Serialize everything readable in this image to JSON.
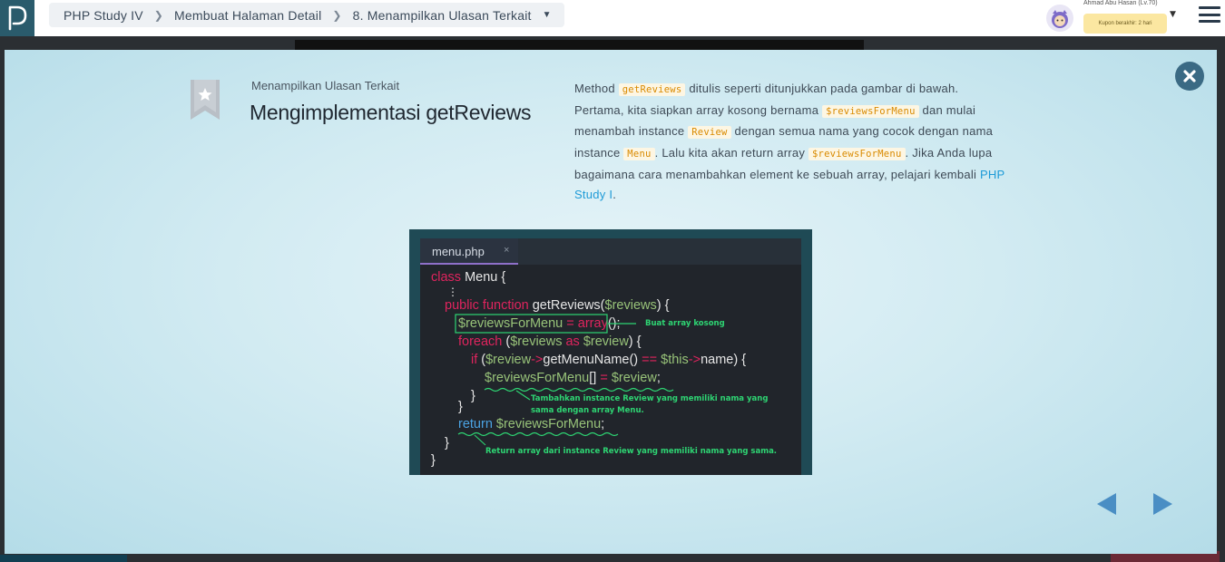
{
  "topbar": {
    "breadcrumb": [
      "PHP Study IV",
      "Membuat Halaman Detail",
      "8. Menampilkan Ulasan Terkait"
    ],
    "user_name": "Ahmad Abu Hasan (Lv.70)",
    "coupon_text": "Kupon berakhir: 2 hari"
  },
  "modal": {
    "subtitle": "Menampilkan Ulasan Terkait",
    "title": "Mengimplementasi getReviews",
    "description": {
      "t1": "Method ",
      "c1": "getReviews",
      "t2": " ditulis seperti ditunjukkan pada gambar di bawah. Pertama, kita siapkan array kosong bernama ",
      "c2": "$reviewsForMenu",
      "t3": " dan mulai menambah instance ",
      "c3": "Review",
      "t4": " dengan semua nama yang cocok dengan nama instance ",
      "c4": "Menu",
      "t5": ". Lalu kita akan return array ",
      "c5": "$reviewsForMenu",
      "t6": ". Jika Anda lupa bagaimana cara menambahkan element ke sebuah array, pelajari kembali ",
      "link": "PHP Study I",
      "t7": "."
    }
  },
  "code_image": {
    "tab_name": "menu.php",
    "tab_close": "×",
    "lines": {
      "l1a": "class",
      "l1b": " Menu {",
      "l2": "⋮",
      "l3a": "public function",
      "l3b": " getReviews(",
      "l3c": "$reviews",
      "l3d": ") {",
      "l4a": "$reviewsForMenu",
      "l4b": " = ",
      "l4c": "array",
      "l4d": "();",
      "l5a": "foreach",
      "l5b": " (",
      "l5c": "$reviews",
      "l5d": " as ",
      "l5e": "$review",
      "l5f": ") {",
      "l6a": "if",
      "l6b": " (",
      "l6c": "$review",
      "l6d": "->",
      "l6e": "getMenuName() ",
      "l6f": "==",
      "l6g": " $this",
      "l6h": "->",
      "l6i": "name) {",
      "l7a": "$reviewsForMenu",
      "l7b": "[] ",
      "l7c": "=",
      "l7d": " $review",
      "l7e": ";",
      "l8": "}",
      "l9": "}",
      "l10a": "return",
      "l10b": " $reviewsForMenu",
      "l10c": ";",
      "l11": "}",
      "l12": "}"
    },
    "annotations": {
      "a1": "Buat array kosong",
      "a2_1": "Tambahkan instance Review yang memiliki nama yang",
      "a2_2": "sama dengan array Menu.",
      "a3": "Return array dari instance Review yang memiliki nama yang sama."
    }
  },
  "colors": {
    "accent_link": "#1e9bd7",
    "code_highlight": "#d98a00",
    "annotation_green": "#2ed573"
  },
  "icons": {
    "logo": "progate-logo-icon",
    "close": "close-icon",
    "bookmark": "bookmark-star-icon",
    "prev": "arrow-left-icon",
    "next": "arrow-right-icon",
    "menu": "hamburger-menu-icon"
  }
}
